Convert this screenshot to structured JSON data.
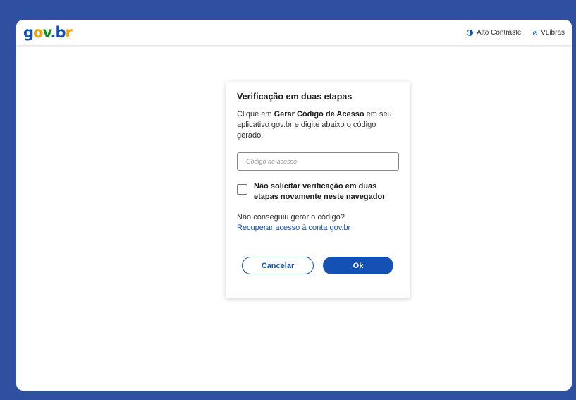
{
  "header": {
    "logo": {
      "g": "g",
      "o": "o",
      "v": "v",
      "dot": ".",
      "b": "b",
      "r": "r"
    },
    "contrast_label": "Alto Contraste",
    "libras_label": "VLibras",
    "icons": [
      "contrast-icon",
      "vlibras-icon"
    ]
  },
  "dialog": {
    "title": "Verificação em duas etapas",
    "desc_prefix": "Clique em ",
    "desc_bold": "Gerar Código de Acesso",
    "desc_suffix": " em seu aplicativo gov.br e digite abaixo o código gerado.",
    "code_placeholder": "Código de acesso",
    "code_value": "",
    "remember_label": "Não solicitar verificação em duas etapas novamente neste navegador",
    "remember_checked": false,
    "help_text": "Não conseguiu gerar o código?",
    "help_link": "Recuperar acesso à conta gov.br",
    "cancel_label": "Cancelar",
    "ok_label": "Ok"
  },
  "colors": {
    "brand_blue": "#1351b4",
    "frame_blue": "#2f4fa0",
    "logo_yellow": "#f5a300",
    "logo_green": "#168821"
  }
}
